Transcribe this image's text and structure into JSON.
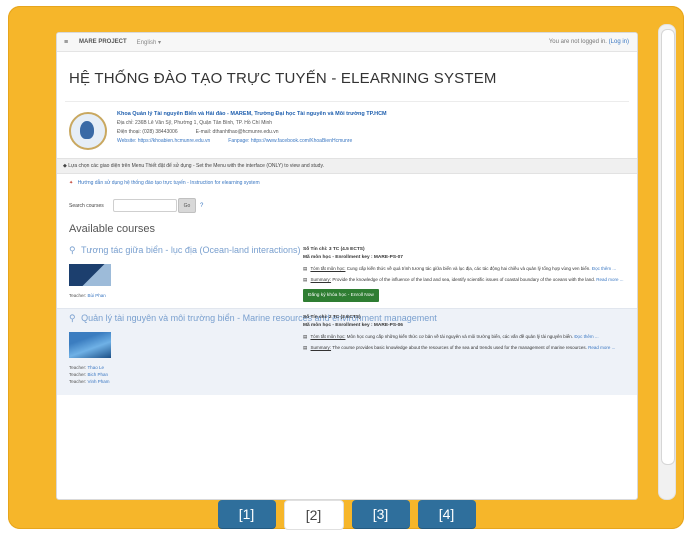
{
  "topbar": {
    "menu_icon": "menu-icon",
    "site_name": "MARE PROJECT",
    "language": "English ▾",
    "login_text": "You are not logged in.",
    "login_link": "(Log in)"
  },
  "page": {
    "title": "HỆ THỐNG ĐÀO TẠO TRỰC TUYẾN - ELEARNING SYSTEM"
  },
  "faculty": {
    "name": "Khoa Quản lý Tài nguyên Biển và Hải đảo - MAREM, Trường Đại học Tài nguyên và Môi trường TP.HCM",
    "address": "Địa chỉ: 236B Lê Văn Sỹ, Phường 1, Quận Tân Bình, TP. Hồ Chí Minh",
    "phone": "Điện thoại: (028) 38443006",
    "email": "E-mail: dthanhthao@hcmunre.edu.vn",
    "website": "Website: https://khoabien.hcmunre.edu.vn",
    "fanpage": "Fanpage: https://www.facebook.com/KhoaBienHcmunre"
  },
  "notice": {
    "text": "◆ Lựa chọn các giao diện trên Menu Thiết đặt để sử dụng - Set the Menu with the interface (ONLY) to view and study."
  },
  "guide": {
    "text": "Hướng dẫn sử dụng hệ thống đào tạo trực tuyến - Instruction for elearning system"
  },
  "search": {
    "label": "Search courses",
    "button": "Go",
    "placeholder": ""
  },
  "available_heading": "Available courses",
  "courses": [
    {
      "title": "Tương tác giữa biển - lục địa (Ocean-land interactions)",
      "teacher_label": "Teacher:",
      "teachers": [
        "Bùi Phan"
      ],
      "credits": "Số Tín chỉ: 3 TC (4.5 ECTS)",
      "enrol_key": "Mã môn học - Enrollment key : MARE-PS-07",
      "summary_label": "Tóm tắt môn học:",
      "summary": "Cung cấp kiến thức về quá trình tương tác giữa biển và lục địa, các tác động hai chiều và quản lý tổng hợp vùng ven biển.",
      "summary_more": "Đọc thêm ...",
      "summary_en_label": "Summary:",
      "summary_en": "Provide the knowledge of the influence of the land and sea, identify scientific issues of coastal boundary of the oceans with the land.",
      "summary_en_more": "Read more ...",
      "button": "Đăng ký khóa học - Enroll Now"
    },
    {
      "title": "Quản lý tài nguyên và môi trường biển - Marine resources and environment management",
      "teacher_label": "Teacher:",
      "teachers": [
        "Thao Le",
        "Bich Phan",
        "Vinh Pham"
      ],
      "credits": "Số Tín chỉ: 2 TC (3 ECTS)",
      "enrol_key": "Mã môn học - Enrollment key : MARE-PS-06",
      "summary_label": "Tóm tắt môn học:",
      "summary": "Môn học cung cấp những kiến thức cơ bản về tài nguyên và môi trường biển, các vấn đề quản lý tài nguyên biển.",
      "summary_more": "Đọc thêm ...",
      "summary_en_label": "Summary:",
      "summary_en": "The course provides basic knowledge about the resources of the sea and trends used for the management of marine resources.",
      "summary_en_more": "Read more ..."
    }
  ],
  "pagination": {
    "pages": [
      "[1]",
      "[2]",
      "[3]",
      "[4]"
    ],
    "active_index": 1
  },
  "colors": {
    "frame": "#f6b62a",
    "page_button": "#2f6f9c",
    "enroll_button": "#2e7d32",
    "link": "#3a77c2"
  }
}
